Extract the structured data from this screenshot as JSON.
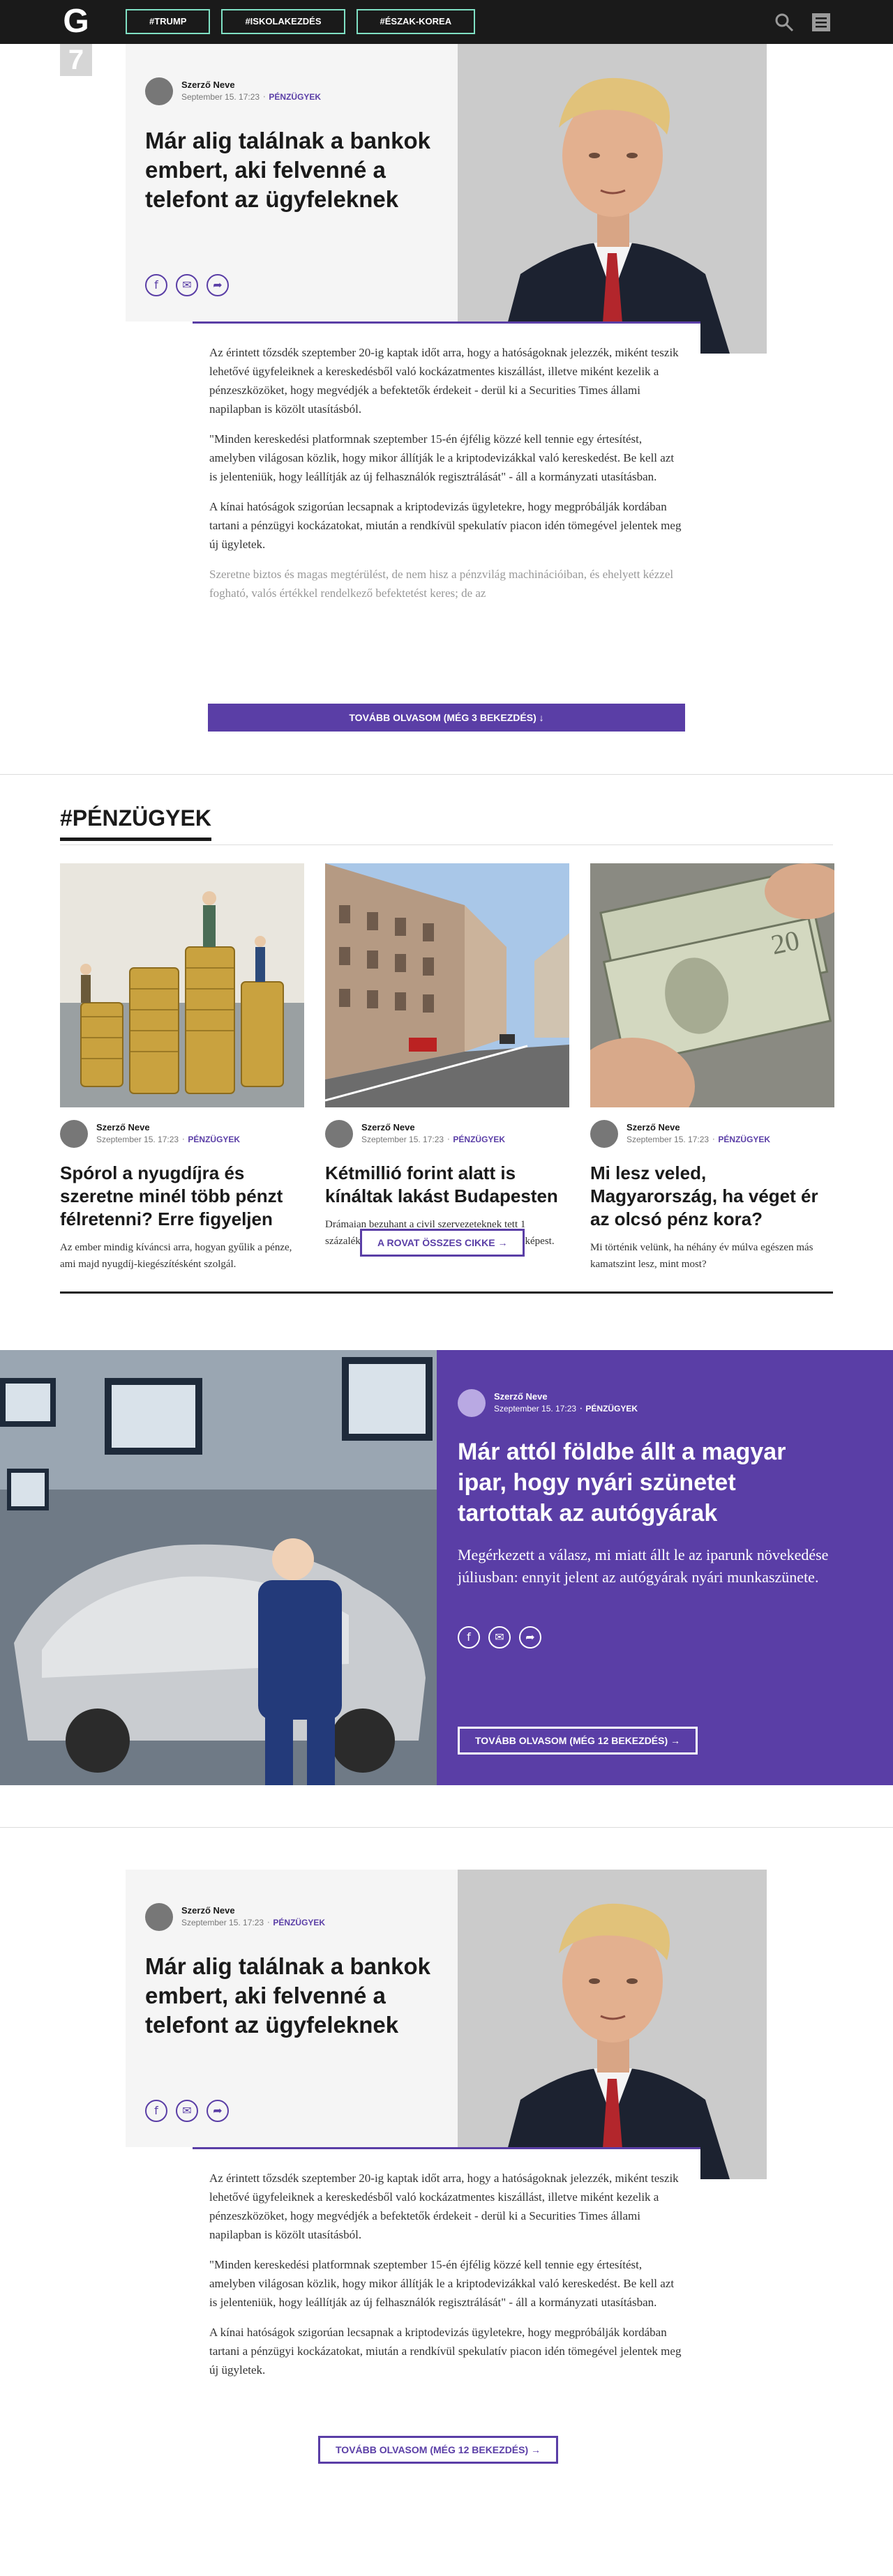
{
  "header": {
    "logo": "G",
    "tags": [
      "#TRUMP",
      "#ISKOLAKEZDÉS",
      "#ÉSZAK-KOREA"
    ]
  },
  "feature1": {
    "rank": "7",
    "author": "Szerző Neve",
    "date": "September 15. 17:23",
    "category": "PÉNZÜGYEK",
    "title": "Már alig találnak a bankok embert, aki felvenné a telefont az ügyfeleknek",
    "paragraphs": [
      "Az érintett tőzsdék szeptember 20-ig kaptak időt arra, hogy a hatóságoknak jelezzék, miként teszik lehetővé ügyfeleiknek a kereskedésből való kockázatmentes kiszállást, illetve miként kezelik a pénzeszközöket, hogy megvédjék a befektetők érdekeit - derül ki a Securities Times állami napilapban is közölt utasításból.",
      "\"Minden kereskedési platformnak szeptember 15-én éjfélig közzé kell tennie egy értesítést, amelyben világosan közlik, hogy mikor állítják le a kriptodevizákkal való kereskedést. Be kell azt is jelenteniük, hogy leállítják az új felhasználók regisztrálását\" - áll a kormányzati utasításban.",
      "A kínai hatóságok szigorúan lecsapnak a kriptodevizás ügyletekre, hogy megpróbálják kordában tartani a pénzügyi kockázatokat, miután a rendkívül spekulatív piacon idén tömegével jelentek meg új ügyletek.",
      "Szeretne biztos és magas megtérülést, de nem hisz a pénzvilág machinációiban, és ehelyett kézzel fogható, valós értékkel rendelkező befektetést keres; de az"
    ],
    "more": "TOVÁBB OLVASOM (MÉG 3 BEKEZDÉS)"
  },
  "section": {
    "title": "#PÉNZÜGYEK",
    "cards": [
      {
        "author": "Szerző Neve",
        "date": "Szeptember 15. 17:23",
        "category": "PÉNZÜGYEK",
        "title": "Spórol a nyugdíjra és szeretne minél több pénzt félretenni? Erre figyeljen",
        "lead": "Az ember mindig kíváncsi arra, hogyan gyűlik a pénze, ami majd nyugdíj-kiegészítésként szolgál."
      },
      {
        "author": "Szerző Neve",
        "date": "Szeptember 15. 17:23",
        "category": "PÉNZÜGYEK",
        "title": "Kétmillió forint alatt is kínáltak lakást Budapesten",
        "lead": "Drámaian bezuhant a civil szervezeteknek tett 1 százalékos felajánlások összege az előző évhez képest."
      },
      {
        "author": "Szerző Neve",
        "date": "Szeptember 15. 17:23",
        "category": "PÉNZÜGYEK",
        "title": "Mi lesz veled, Magyarország, ha véget ér az olcsó pénz kora?",
        "lead": "Mi történik velünk, ha néhány év múlva egészen más kamatszint lesz, mint most?"
      }
    ],
    "more": "A ROVAT ÖSSZES CIKKE"
  },
  "promo": {
    "author": "Szerző Neve",
    "date": "Szeptember 15. 17:23",
    "category": "PÉNZÜGYEK",
    "title": "Már attól földbe állt a magyar ipar, hogy nyári szünetet tartottak az autógyárak",
    "lead": "Megérkezett a válasz, mi miatt állt le az iparunk növekedése júliusban: ennyit jelent az autógyárak nyári munkaszünete.",
    "more": "TOVÁBB OLVASOM (MÉG 12 BEKEZDÉS)"
  },
  "feature2": {
    "author": "Szerző Neve",
    "date": "Szeptember 15. 17:23",
    "category": "PÉNZÜGYEK",
    "title": "Már alig találnak a bankok embert, aki felvenné a telefont az ügyfeleknek",
    "paragraphs": [
      "Az érintett tőzsdék szeptember 20-ig kaptak időt arra, hogy a hatóságoknak jelezzék, miként teszik lehetővé ügyfeleiknek a kereskedésből való kockázatmentes kiszállást, illetve miként kezelik a pénzeszközöket, hogy megvédjék a befektetők érdekeit - derül ki a Securities Times állami napilapban is közölt utasításból.",
      "\"Minden kereskedési platformnak szeptember 15-én éjfélig közzé kell tennie egy értesítést, amelyben világosan közlik, hogy mikor állítják le a kriptodevizákkal való kereskedést. Be kell azt is jelenteniük, hogy leállítják az új felhasználók regisztrálását\" - áll a kormányzati utasításban.",
      "A kínai hatóságok szigorúan lecsapnak a kriptodevizás ügyletekre, hogy megpróbálják kordában tartani a pénzügyi kockázatokat, miután a rendkívül spekulatív piacon idén tömegével jelentek meg új ügyletek."
    ],
    "more": "TOVÁBB OLVASOM (MÉG 12 BEKEZDÉS)"
  },
  "icons": {
    "share": [
      "facebook-icon",
      "mail-icon",
      "share-icon"
    ],
    "header": [
      "search-icon",
      "menu-icon"
    ]
  },
  "colors": {
    "accent": "#5a3ea6",
    "tag_border": "#7fe0c4",
    "topbar": "#1a1a1a"
  }
}
